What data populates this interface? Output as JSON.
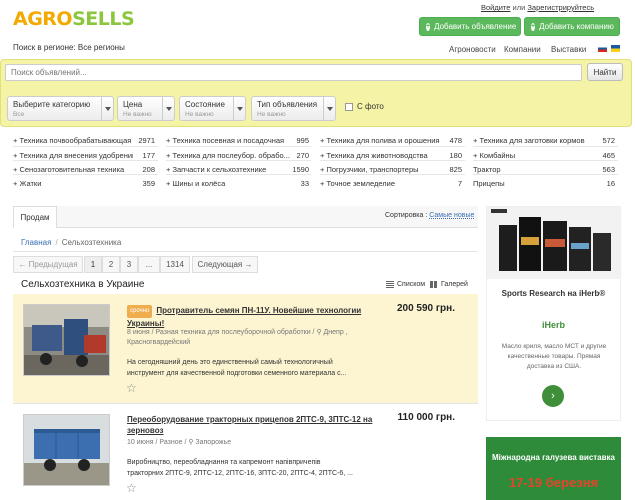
{
  "header": {
    "logo_part1": "AGRO",
    "logo_part2": "SELLS",
    "login": "Войдите",
    "or": "или",
    "register": "Зарегистрируйтесь",
    "add_ad": "Добавить объявление",
    "add_company": "Добавить компанию",
    "region_label": "Поиск в регионе:",
    "region_value": "Все регионы",
    "nav": [
      "Агроновости",
      "Компании",
      "Выставки"
    ]
  },
  "search": {
    "placeholder": "Поиск объявлений...",
    "button": "Найти",
    "filters": [
      {
        "title": "Выберите категорию",
        "value": "Все"
      },
      {
        "title": "Цена",
        "value": "Не важно"
      },
      {
        "title": "Состояние",
        "value": "Не важно"
      },
      {
        "title": "Тип объявления",
        "value": "Не важно"
      }
    ],
    "photo_label": "С фото"
  },
  "categories": [
    [
      {
        "name": "+ Техника почвообрабатывающая",
        "count": "2971"
      },
      {
        "name": "+ Техника для внесения удобрений",
        "count": "177"
      },
      {
        "name": "+ Сенозаготовительная техника",
        "count": "208"
      },
      {
        "name": "+ Жатки",
        "count": "359"
      }
    ],
    [
      {
        "name": "+ Техника посевная и посадочная",
        "count": "995"
      },
      {
        "name": "+ Техника для послеубор. обрабо...",
        "count": "270"
      },
      {
        "name": "+ Запчасти к сельхозтехнике",
        "count": "1590"
      },
      {
        "name": "+ Шины и колёса",
        "count": "33"
      }
    ],
    [
      {
        "name": "+ Техника для полива и орошения",
        "count": "478"
      },
      {
        "name": "+ Техника для животноводства",
        "count": "180"
      },
      {
        "name": "+ Погрузчики, транспортеры",
        "count": "825"
      },
      {
        "name": "+ Точное земледелие",
        "count": "7"
      }
    ],
    [
      {
        "name": "+ Техника для заготовки кормов",
        "count": "572"
      },
      {
        "name": "+ Комбайны",
        "count": "465"
      },
      {
        "name": "Трактор",
        "count": "563"
      },
      {
        "name": "Прицепы",
        "count": "16"
      }
    ]
  ],
  "tabs": {
    "active": "Продам"
  },
  "sort": {
    "label": "Сортировка :",
    "value": "Самые новые"
  },
  "breadcrumb": {
    "home": "Главная",
    "sep": "/",
    "current": "Сельхозтехника"
  },
  "pagination": {
    "prev": "← Предыдущая",
    "pages": [
      "1",
      "2",
      "3",
      "...",
      "1314"
    ],
    "next": "Следующая →"
  },
  "section": {
    "title": "Сельхозтехника в Украине",
    "view_list": "Списком",
    "view_gallery": "Галерей"
  },
  "listings": [
    {
      "badge": "срочно",
      "title": "Протравитель семян ПН-11У. Новейшие технологии Украины!",
      "price": "200 590 грн.",
      "meta1": "8 июня / Разная техника для послеуборочной обработки / ⚲ Днепр ,",
      "meta2": "Красногвардейский",
      "desc1": "На сегодняшний день это единственный самый технологичный",
      "desc2": "инструмент для качественной подготовки семенного материала с..."
    },
    {
      "title": "Переоборудование тракторных прицепов 2ПТС-9, 3ПТС-12 на",
      "title2": "зерновоз",
      "price": "110 000 грн.",
      "meta1": "10 июня / Разное / ⚲ Запорожье",
      "desc1": "Виробництво, переобладнання та капремонт напівпричепів",
      "desc2": "тракторних 2ПТС-9, 2ПТС-12, 2ПТС-16, 3ПТС-20, 2ПТС-4, 2ПТС-6, ..."
    }
  ],
  "ads": {
    "ad1_title": "Sports Research на iHerb®",
    "ad1_brand": "iHerb",
    "ad1_text": "Масло криля, масло МСТ и другие качественные товары. Прямая доставка из США.",
    "ad2_title": "Міжнародна галузева виставка",
    "ad2_date": "17-19 березня"
  },
  "colors": {
    "accent_green": "#5cb85c",
    "search_bg": "#f5f3a5",
    "highlight_bg": "#fdf5d2",
    "link_blue": "#3a6fb4"
  }
}
